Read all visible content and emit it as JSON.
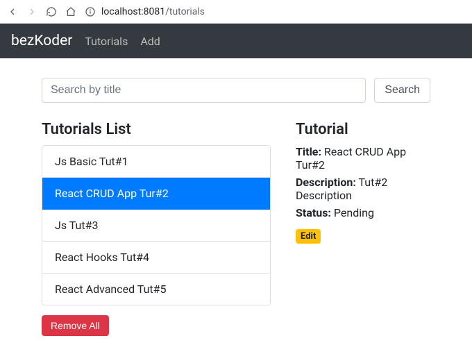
{
  "browser": {
    "host": "localhost:8081",
    "path": "/tutorials"
  },
  "navbar": {
    "brand": "bezKoder",
    "links": [
      "Tutorials",
      "Add"
    ]
  },
  "search": {
    "placeholder": "Search by title",
    "value": "",
    "button": "Search"
  },
  "list": {
    "heading": "Tutorials List",
    "items": [
      "Js Basic Tut#1",
      "React CRUD App Tur#2",
      "Js Tut#3",
      "React Hooks Tut#4",
      "React Advanced Tut#5"
    ],
    "active_index": 1,
    "remove_all": "Remove All"
  },
  "detail": {
    "heading": "Tutorial",
    "title_label": "Title:",
    "title_value": "React CRUD App Tur#2",
    "description_label": "Description:",
    "description_value": "Tut#2 Description",
    "status_label": "Status:",
    "status_value": "Pending",
    "edit": "Edit"
  },
  "colors": {
    "primary": "#007bff",
    "danger": "#dc3545",
    "warning": "#ffc107",
    "navbar": "#343a40"
  }
}
